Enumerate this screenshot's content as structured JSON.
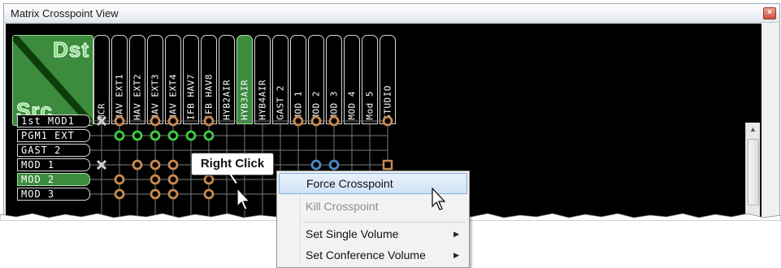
{
  "window": {
    "title": "Matrix Crosspoint View",
    "close_glyph": "×"
  },
  "corner": {
    "dst_label": "Dst",
    "src_label": "Src"
  },
  "columns": [
    {
      "label": "MCR",
      "active": false
    },
    {
      "label": "HAV EXT1",
      "active": false
    },
    {
      "label": "HAV EXT2",
      "active": false
    },
    {
      "label": "HAV EXT3",
      "active": false
    },
    {
      "label": "HAV EXT4",
      "active": false
    },
    {
      "label": "IFB HAV7",
      "active": false
    },
    {
      "label": "IFB HAV8",
      "active": false
    },
    {
      "label": "HYB2AIR",
      "active": false
    },
    {
      "label": "HYB3AIR",
      "active": true
    },
    {
      "label": "HYB4AIR",
      "active": false
    },
    {
      "label": "GAST 2",
      "active": false
    },
    {
      "label": "MOD 1",
      "active": false
    },
    {
      "label": "MOD 2",
      "active": false
    },
    {
      "label": "MOD 3",
      "active": false
    },
    {
      "label": "MOD 4",
      "active": false
    },
    {
      "label": "Mod 5",
      "active": false
    },
    {
      "label": "STUDIO",
      "active": false
    }
  ],
  "rows": [
    {
      "label": "1st MOD1",
      "active": false
    },
    {
      "label": "PGM1 EXT",
      "active": false
    },
    {
      "label": "GAST 2",
      "active": false
    },
    {
      "label": "MOD 1",
      "active": false
    },
    {
      "label": "MOD 2",
      "active": true
    },
    {
      "label": "MOD 3",
      "active": false
    }
  ],
  "crosspoints": [
    {
      "row": 0,
      "col": 0,
      "type": "x"
    },
    {
      "row": 0,
      "col": 1,
      "type": "orange"
    },
    {
      "row": 0,
      "col": 3,
      "type": "orange"
    },
    {
      "row": 0,
      "col": 4,
      "type": "orange"
    },
    {
      "row": 0,
      "col": 6,
      "type": "orange"
    },
    {
      "row": 0,
      "col": 11,
      "type": "orange"
    },
    {
      "row": 0,
      "col": 12,
      "type": "orange"
    },
    {
      "row": 0,
      "col": 13,
      "type": "orange"
    },
    {
      "row": 0,
      "col": 16,
      "type": "orange"
    },
    {
      "row": 1,
      "col": 1,
      "type": "green"
    },
    {
      "row": 1,
      "col": 2,
      "type": "green"
    },
    {
      "row": 1,
      "col": 3,
      "type": "green"
    },
    {
      "row": 1,
      "col": 4,
      "type": "green"
    },
    {
      "row": 1,
      "col": 5,
      "type": "green"
    },
    {
      "row": 1,
      "col": 6,
      "type": "green"
    },
    {
      "row": 3,
      "col": 0,
      "type": "x"
    },
    {
      "row": 3,
      "col": 2,
      "type": "orange"
    },
    {
      "row": 3,
      "col": 3,
      "type": "orange"
    },
    {
      "row": 3,
      "col": 4,
      "type": "orange"
    },
    {
      "row": 3,
      "col": 12,
      "type": "blue"
    },
    {
      "row": 3,
      "col": 13,
      "type": "blue"
    },
    {
      "row": 3,
      "col": 16,
      "type": "square"
    },
    {
      "row": 4,
      "col": 1,
      "type": "orange"
    },
    {
      "row": 4,
      "col": 3,
      "type": "orange"
    },
    {
      "row": 4,
      "col": 4,
      "type": "orange"
    },
    {
      "row": 4,
      "col": 6,
      "type": "orange"
    },
    {
      "row": 5,
      "col": 1,
      "type": "orange"
    },
    {
      "row": 5,
      "col": 3,
      "type": "orange"
    },
    {
      "row": 5,
      "col": 4,
      "type": "orange"
    },
    {
      "row": 5,
      "col": 6,
      "type": "orange"
    }
  ],
  "colors": {
    "orange": "#c98a4e",
    "green": "#3fcf3f",
    "blue": "#4a88c8",
    "x": "#cfcfcf",
    "grid_line": "#7a7a7a"
  },
  "callout": {
    "text": "Right Click"
  },
  "context_menu": {
    "items": [
      {
        "label": "Force Crosspoint",
        "state": "highlighted",
        "submenu": false
      },
      {
        "label": "Kill Crosspoint",
        "state": "disabled",
        "submenu": false
      },
      {
        "label": "Set Single Volume",
        "state": "normal",
        "submenu": true
      },
      {
        "label": "Set Conference Volume",
        "state": "normal",
        "submenu": true
      }
    ],
    "submenu_arrow": "▶"
  },
  "scrollbar": {
    "up_glyph": "▲"
  }
}
